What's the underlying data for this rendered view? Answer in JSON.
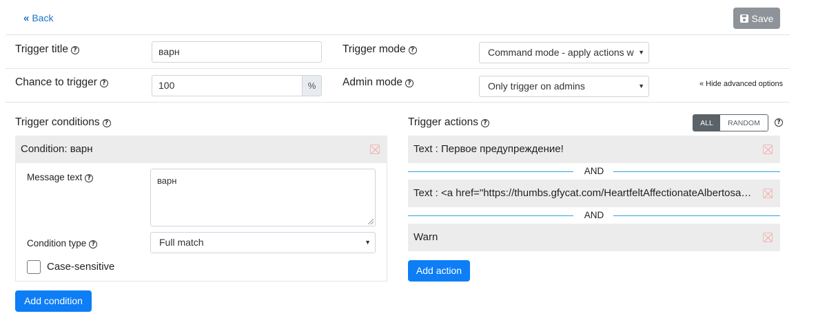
{
  "header": {
    "back_label": "Back",
    "save_label": "Save"
  },
  "form": {
    "trigger_title_label": "Trigger title",
    "trigger_title_value": "варн",
    "trigger_mode_label": "Trigger mode",
    "trigger_mode_value": "Command mode - apply actions w",
    "chance_label": "Chance to trigger",
    "chance_value": "100",
    "chance_unit": "%",
    "admin_mode_label": "Admin mode",
    "admin_mode_value": "Only trigger on admins",
    "hide_advanced": "« Hide advanced options"
  },
  "conditions": {
    "title": "Trigger conditions",
    "items": [
      {
        "header": "Condition: варн",
        "message_text_label": "Message text",
        "message_text_value": "варн",
        "condition_type_label": "Condition type",
        "condition_type_value": "Full match",
        "case_sensitive_label": "Case-sensitive",
        "case_sensitive_checked": false
      }
    ],
    "add_label": "Add condition"
  },
  "actions": {
    "title": "Trigger actions",
    "mode_options": [
      "ALL",
      "RANDOM"
    ],
    "mode_selected": "ALL",
    "items": [
      {
        "text": "Text : Первое предупреждение!"
      },
      {
        "text": "Text : <a href=\"https://thumbs.gfycat.com/HeartfeltAffectionateAlbertosaurus-small.gif\">"
      },
      {
        "text": "Warn"
      }
    ],
    "separator_label": "AND",
    "add_label": "Add action"
  },
  "colors": {
    "primary": "#0d7ef5",
    "save_disabled": "#8d9399",
    "separator": "#27a5e0",
    "link": "#1a73c8"
  }
}
